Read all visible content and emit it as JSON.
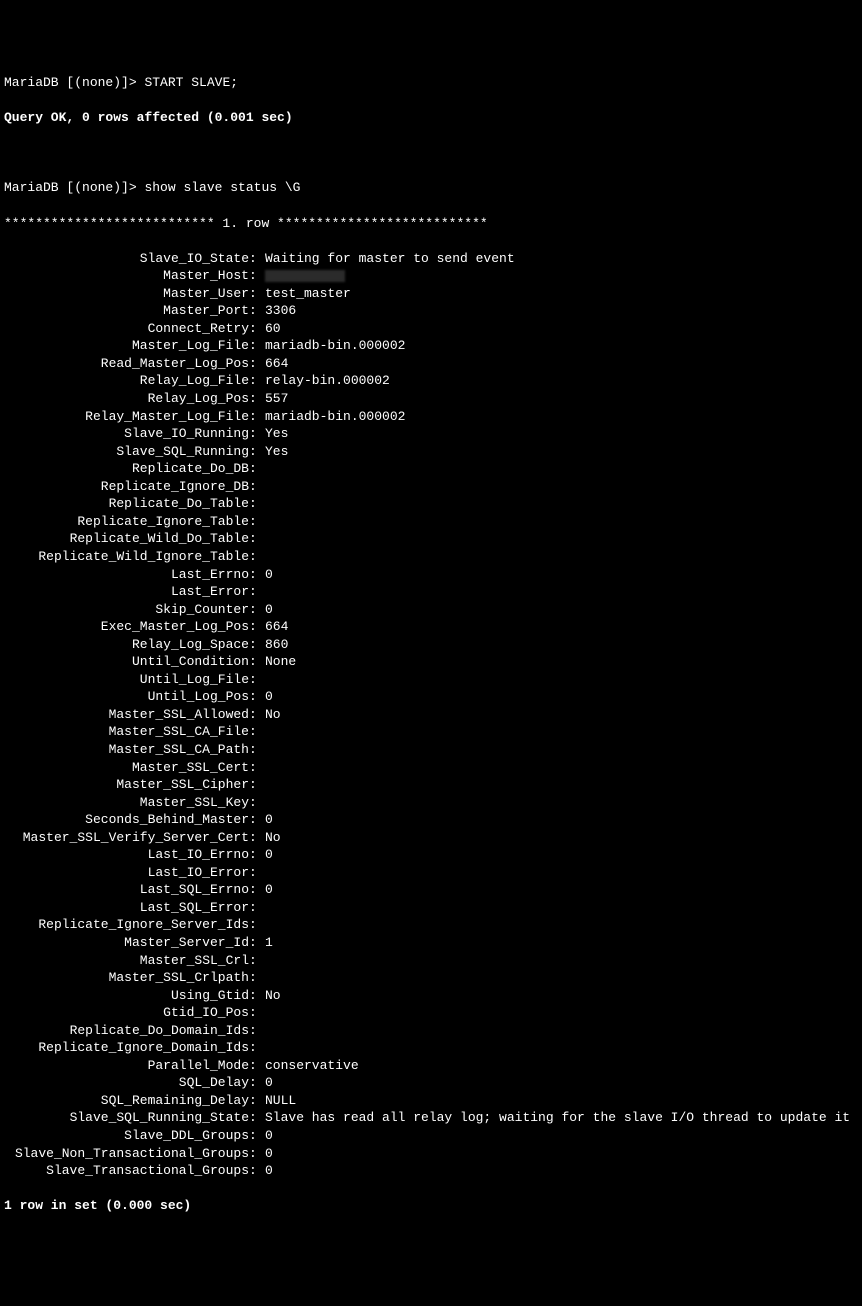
{
  "prompt1": "MariaDB [(none)]> ",
  "cmd1": "START SLAVE;",
  "result1": "Query OK, 0 rows affected (0.001 sec)",
  "prompt2": "MariaDB [(none)]> ",
  "cmd2": "show slave status \\G",
  "row_header": "*************************** 1. row ***************************",
  "status": [
    {
      "k": "Slave_IO_State",
      "v": "Waiting for master to send event"
    },
    {
      "k": "Master_Host",
      "v": "",
      "redacted": true
    },
    {
      "k": "Master_User",
      "v": "test_master"
    },
    {
      "k": "Master_Port",
      "v": "3306"
    },
    {
      "k": "Connect_Retry",
      "v": "60"
    },
    {
      "k": "Master_Log_File",
      "v": "mariadb-bin.000002"
    },
    {
      "k": "Read_Master_Log_Pos",
      "v": "664"
    },
    {
      "k": "Relay_Log_File",
      "v": "relay-bin.000002"
    },
    {
      "k": "Relay_Log_Pos",
      "v": "557"
    },
    {
      "k": "Relay_Master_Log_File",
      "v": "mariadb-bin.000002"
    },
    {
      "k": "Slave_IO_Running",
      "v": "Yes"
    },
    {
      "k": "Slave_SQL_Running",
      "v": "Yes"
    },
    {
      "k": "Replicate_Do_DB",
      "v": ""
    },
    {
      "k": "Replicate_Ignore_DB",
      "v": ""
    },
    {
      "k": "Replicate_Do_Table",
      "v": ""
    },
    {
      "k": "Replicate_Ignore_Table",
      "v": ""
    },
    {
      "k": "Replicate_Wild_Do_Table",
      "v": ""
    },
    {
      "k": "Replicate_Wild_Ignore_Table",
      "v": ""
    },
    {
      "k": "Last_Errno",
      "v": "0"
    },
    {
      "k": "Last_Error",
      "v": ""
    },
    {
      "k": "Skip_Counter",
      "v": "0"
    },
    {
      "k": "Exec_Master_Log_Pos",
      "v": "664"
    },
    {
      "k": "Relay_Log_Space",
      "v": "860"
    },
    {
      "k": "Until_Condition",
      "v": "None"
    },
    {
      "k": "Until_Log_File",
      "v": ""
    },
    {
      "k": "Until_Log_Pos",
      "v": "0"
    },
    {
      "k": "Master_SSL_Allowed",
      "v": "No"
    },
    {
      "k": "Master_SSL_CA_File",
      "v": ""
    },
    {
      "k": "Master_SSL_CA_Path",
      "v": ""
    },
    {
      "k": "Master_SSL_Cert",
      "v": ""
    },
    {
      "k": "Master_SSL_Cipher",
      "v": ""
    },
    {
      "k": "Master_SSL_Key",
      "v": ""
    },
    {
      "k": "Seconds_Behind_Master",
      "v": "0"
    },
    {
      "k": "Master_SSL_Verify_Server_Cert",
      "v": "No"
    },
    {
      "k": "Last_IO_Errno",
      "v": "0"
    },
    {
      "k": "Last_IO_Error",
      "v": ""
    },
    {
      "k": "Last_SQL_Errno",
      "v": "0"
    },
    {
      "k": "Last_SQL_Error",
      "v": ""
    },
    {
      "k": "Replicate_Ignore_Server_Ids",
      "v": ""
    },
    {
      "k": "Master_Server_Id",
      "v": "1"
    },
    {
      "k": "Master_SSL_Crl",
      "v": ""
    },
    {
      "k": "Master_SSL_Crlpath",
      "v": ""
    },
    {
      "k": "Using_Gtid",
      "v": "No"
    },
    {
      "k": "Gtid_IO_Pos",
      "v": ""
    },
    {
      "k": "Replicate_Do_Domain_Ids",
      "v": ""
    },
    {
      "k": "Replicate_Ignore_Domain_Ids",
      "v": ""
    },
    {
      "k": "Parallel_Mode",
      "v": "conservative"
    },
    {
      "k": "SQL_Delay",
      "v": "0"
    },
    {
      "k": "SQL_Remaining_Delay",
      "v": "NULL"
    },
    {
      "k": "Slave_SQL_Running_State",
      "v": "Slave has read all relay log; waiting for the slave I/O thread to update it"
    },
    {
      "k": "Slave_DDL_Groups",
      "v": "0"
    },
    {
      "k": "Slave_Non_Transactional_Groups",
      "v": "0"
    },
    {
      "k": "Slave_Transactional_Groups",
      "v": "0"
    }
  ],
  "footer": "1 row in set (0.000 sec)"
}
